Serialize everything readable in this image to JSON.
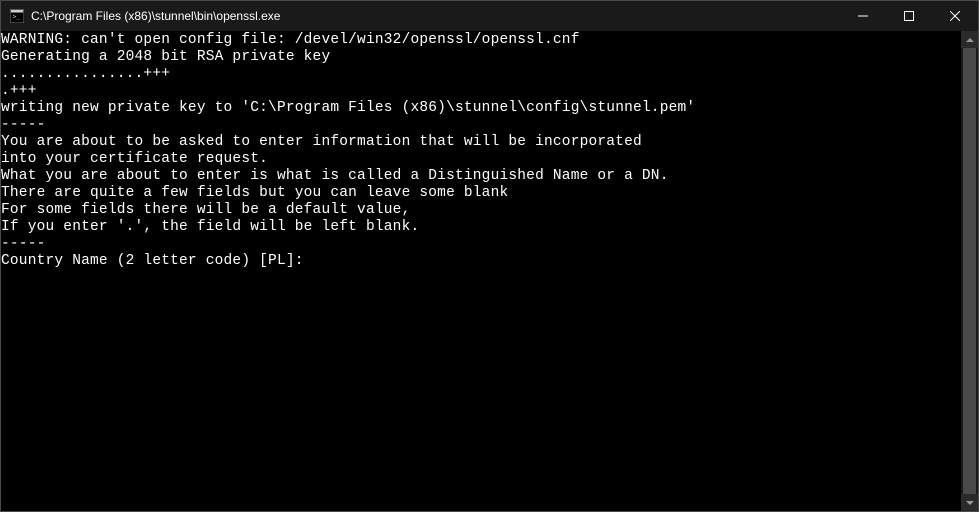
{
  "window": {
    "title": "C:\\Program Files (x86)\\stunnel\\bin\\openssl.exe",
    "icon": "console-app-icon"
  },
  "console": {
    "lines": [
      "WARNING: can't open config file: /devel/win32/openssl/openssl.cnf",
      "Generating a 2048 bit RSA private key",
      "................+++",
      ".+++",
      "writing new private key to 'C:\\Program Files (x86)\\stunnel\\config\\stunnel.pem'",
      "-----",
      "You are about to be asked to enter information that will be incorporated",
      "into your certificate request.",
      "What you are about to enter is what is called a Distinguished Name or a DN.",
      "There are quite a few fields but you can leave some blank",
      "For some fields there will be a default value,",
      "If you enter '.', the field will be left blank.",
      "-----",
      "Country Name (2 letter code) [PL]:"
    ]
  }
}
